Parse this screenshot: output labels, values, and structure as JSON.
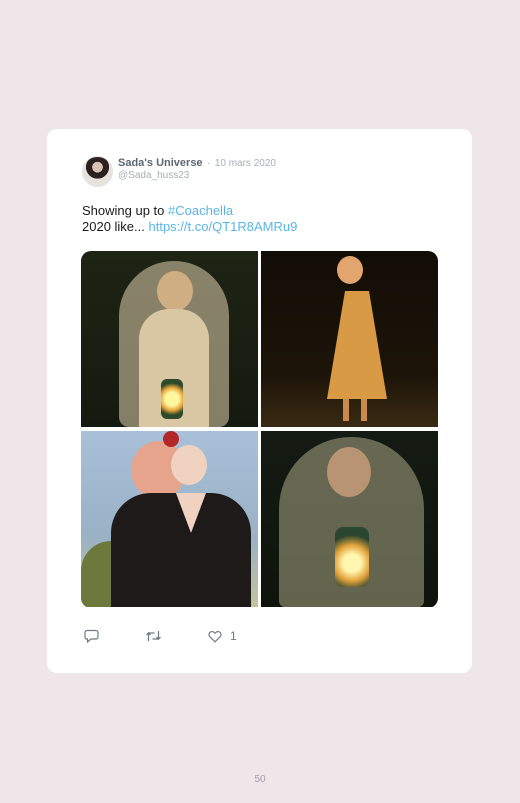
{
  "tweet": {
    "author_name": "Sada's Universe",
    "separator": "·",
    "date": "10 mars 2020",
    "handle": "@Sada_huss23",
    "text_prefix": "Showing up to ",
    "hashtag": "#Coachella",
    "text_line2": "2020 like... ",
    "link": "https://t.co/QT1R8AMRu9",
    "like_count": "1"
  },
  "icons": {
    "reply": "reply-icon",
    "retweet": "retweet-icon",
    "like": "heart-icon"
  },
  "colors": {
    "background": "#efe6ea",
    "card": "#ffffff",
    "link": "#59b5e8"
  },
  "page_number": "50"
}
